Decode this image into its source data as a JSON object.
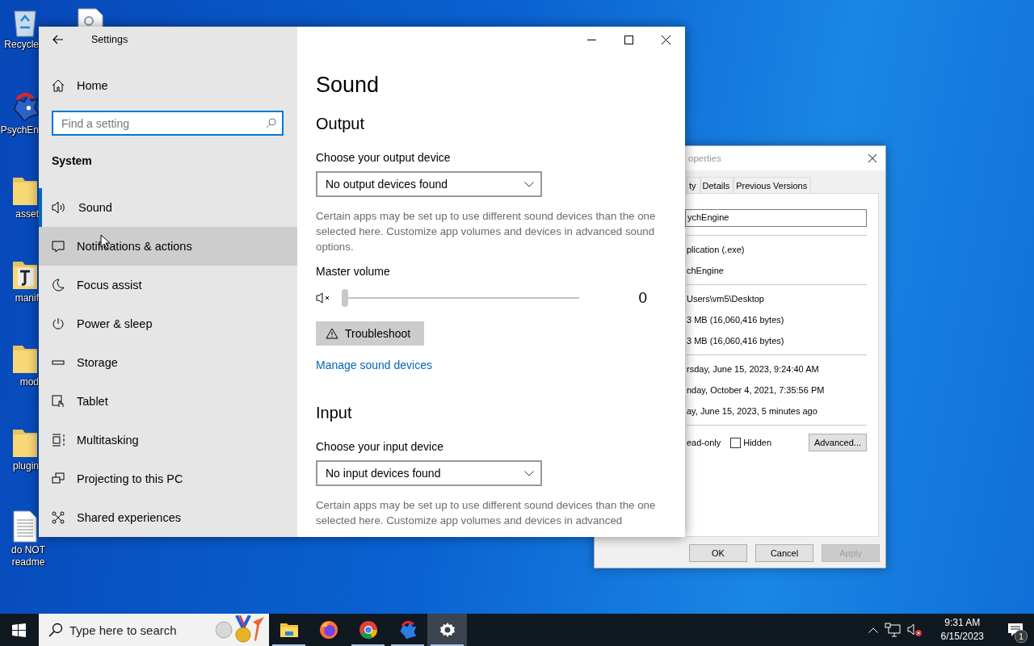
{
  "desktop": {
    "icons": [
      {
        "kind": "recycle",
        "label": "Recycle"
      },
      {
        "kind": "app",
        "label": "PsychEn"
      },
      {
        "kind": "folder",
        "label": "asset"
      },
      {
        "kind": "image-folder",
        "label": "manif"
      },
      {
        "kind": "folder",
        "label": "mod"
      },
      {
        "kind": "folder",
        "label": "plugin"
      },
      {
        "kind": "text-file",
        "label": "do NOT readme"
      }
    ]
  },
  "properties": {
    "title": "operties",
    "tabs": [
      {
        "label": "ty",
        "selected": false
      },
      {
        "label": "Details",
        "selected": false
      },
      {
        "label": "Previous Versions",
        "selected": false
      }
    ],
    "name_field": {
      "value": "ychEngine"
    },
    "groups": [
      [
        "plication (.exe)",
        "chEngine"
      ],
      [
        "Users\\vm5\\Desktop",
        "3 MB (16,060,416 bytes)",
        "3 MB (16,060,416 bytes)"
      ],
      [
        "rsday, June 15, 2023, 9:24:40 AM",
        "nday, October 4, 2021, 7:35:56 PM",
        "ay, June 15, 2023, 5 minutes ago"
      ]
    ],
    "attribute_label": "ead-only",
    "hidden_checkbox": {
      "label": "Hidden",
      "checked": false
    },
    "advanced_button": "Advanced...",
    "buttons": [
      {
        "label": "OK",
        "disabled": false
      },
      {
        "label": "Cancel",
        "disabled": false
      },
      {
        "label": "Apply",
        "disabled": true
      }
    ]
  },
  "settings": {
    "title": "Settings",
    "nav": {
      "home": "Home",
      "search": {
        "placeholder": "Find a setting"
      },
      "section": "System",
      "items": [
        {
          "label": "Sound",
          "selected": true,
          "hovered": false
        },
        {
          "label": "Notifications & actions",
          "selected": false,
          "hovered": true
        },
        {
          "label": "Focus assist",
          "selected": false,
          "hovered": false
        },
        {
          "label": "Power & sleep",
          "selected": false,
          "hovered": false
        },
        {
          "label": "Storage",
          "selected": false,
          "hovered": false
        },
        {
          "label": "Tablet",
          "selected": false,
          "hovered": false
        },
        {
          "label": "Multitasking",
          "selected": false,
          "hovered": false
        },
        {
          "label": "Projecting to this PC",
          "selected": false,
          "hovered": false
        },
        {
          "label": "Shared experiences",
          "selected": false,
          "hovered": false
        }
      ]
    },
    "page": {
      "title": "Sound",
      "output": {
        "heading": "Output",
        "label": "Choose your output device",
        "dropdown": "No output devices found",
        "description": "Certain apps may be set up to use different sound devices than the one selected here. Customize app volumes and devices in advanced sound options."
      },
      "volume": {
        "label": "Master volume",
        "muted": true,
        "level": 0,
        "reading": "0"
      },
      "troubleshoot": "Troubleshoot",
      "link": "Manage sound devices",
      "input": {
        "heading": "Input",
        "label": "Choose your input device",
        "dropdown": "No input devices found",
        "description": "Certain apps may be set up to use different sound devices than the one selected here. Customize app volumes and devices in advanced"
      }
    }
  },
  "taskbar": {
    "search": {
      "placeholder": "Type here to search"
    },
    "apps": [
      {
        "kind": "explorer",
        "running": true,
        "active": false
      },
      {
        "kind": "firefox",
        "running": false,
        "active": false
      },
      {
        "kind": "chrome",
        "running": true,
        "active": false
      },
      {
        "kind": "app",
        "running": true,
        "active": false
      },
      {
        "kind": "settings",
        "running": true,
        "active": true
      }
    ],
    "time": "9:31 AM",
    "date": "6/15/2023",
    "notifications": "1"
  }
}
